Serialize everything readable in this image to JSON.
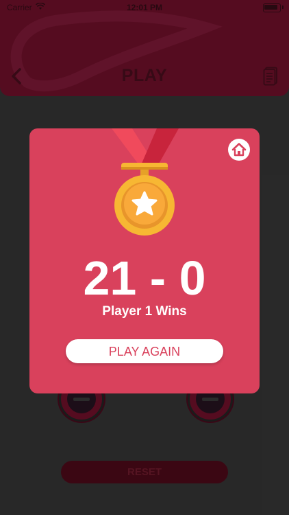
{
  "status_bar": {
    "carrier": "Carrier",
    "time": "12:01 PM"
  },
  "nav": {
    "title": "PLAY"
  },
  "background": {
    "reset_label": "RESET"
  },
  "modal": {
    "score": "21 - 0",
    "winner_text": "Player 1 Wins",
    "play_again_label": "PLAY AGAIN"
  },
  "colors": {
    "modal_bg": "#d9415c",
    "header_bg": "#5a0d22",
    "medal_gold": "#f7b733",
    "ribbon": "#e8304a"
  },
  "icons": [
    "back-chevron-icon",
    "notes-icon",
    "home-icon",
    "medal-icon",
    "star-icon",
    "wifi-icon",
    "battery-icon"
  ]
}
